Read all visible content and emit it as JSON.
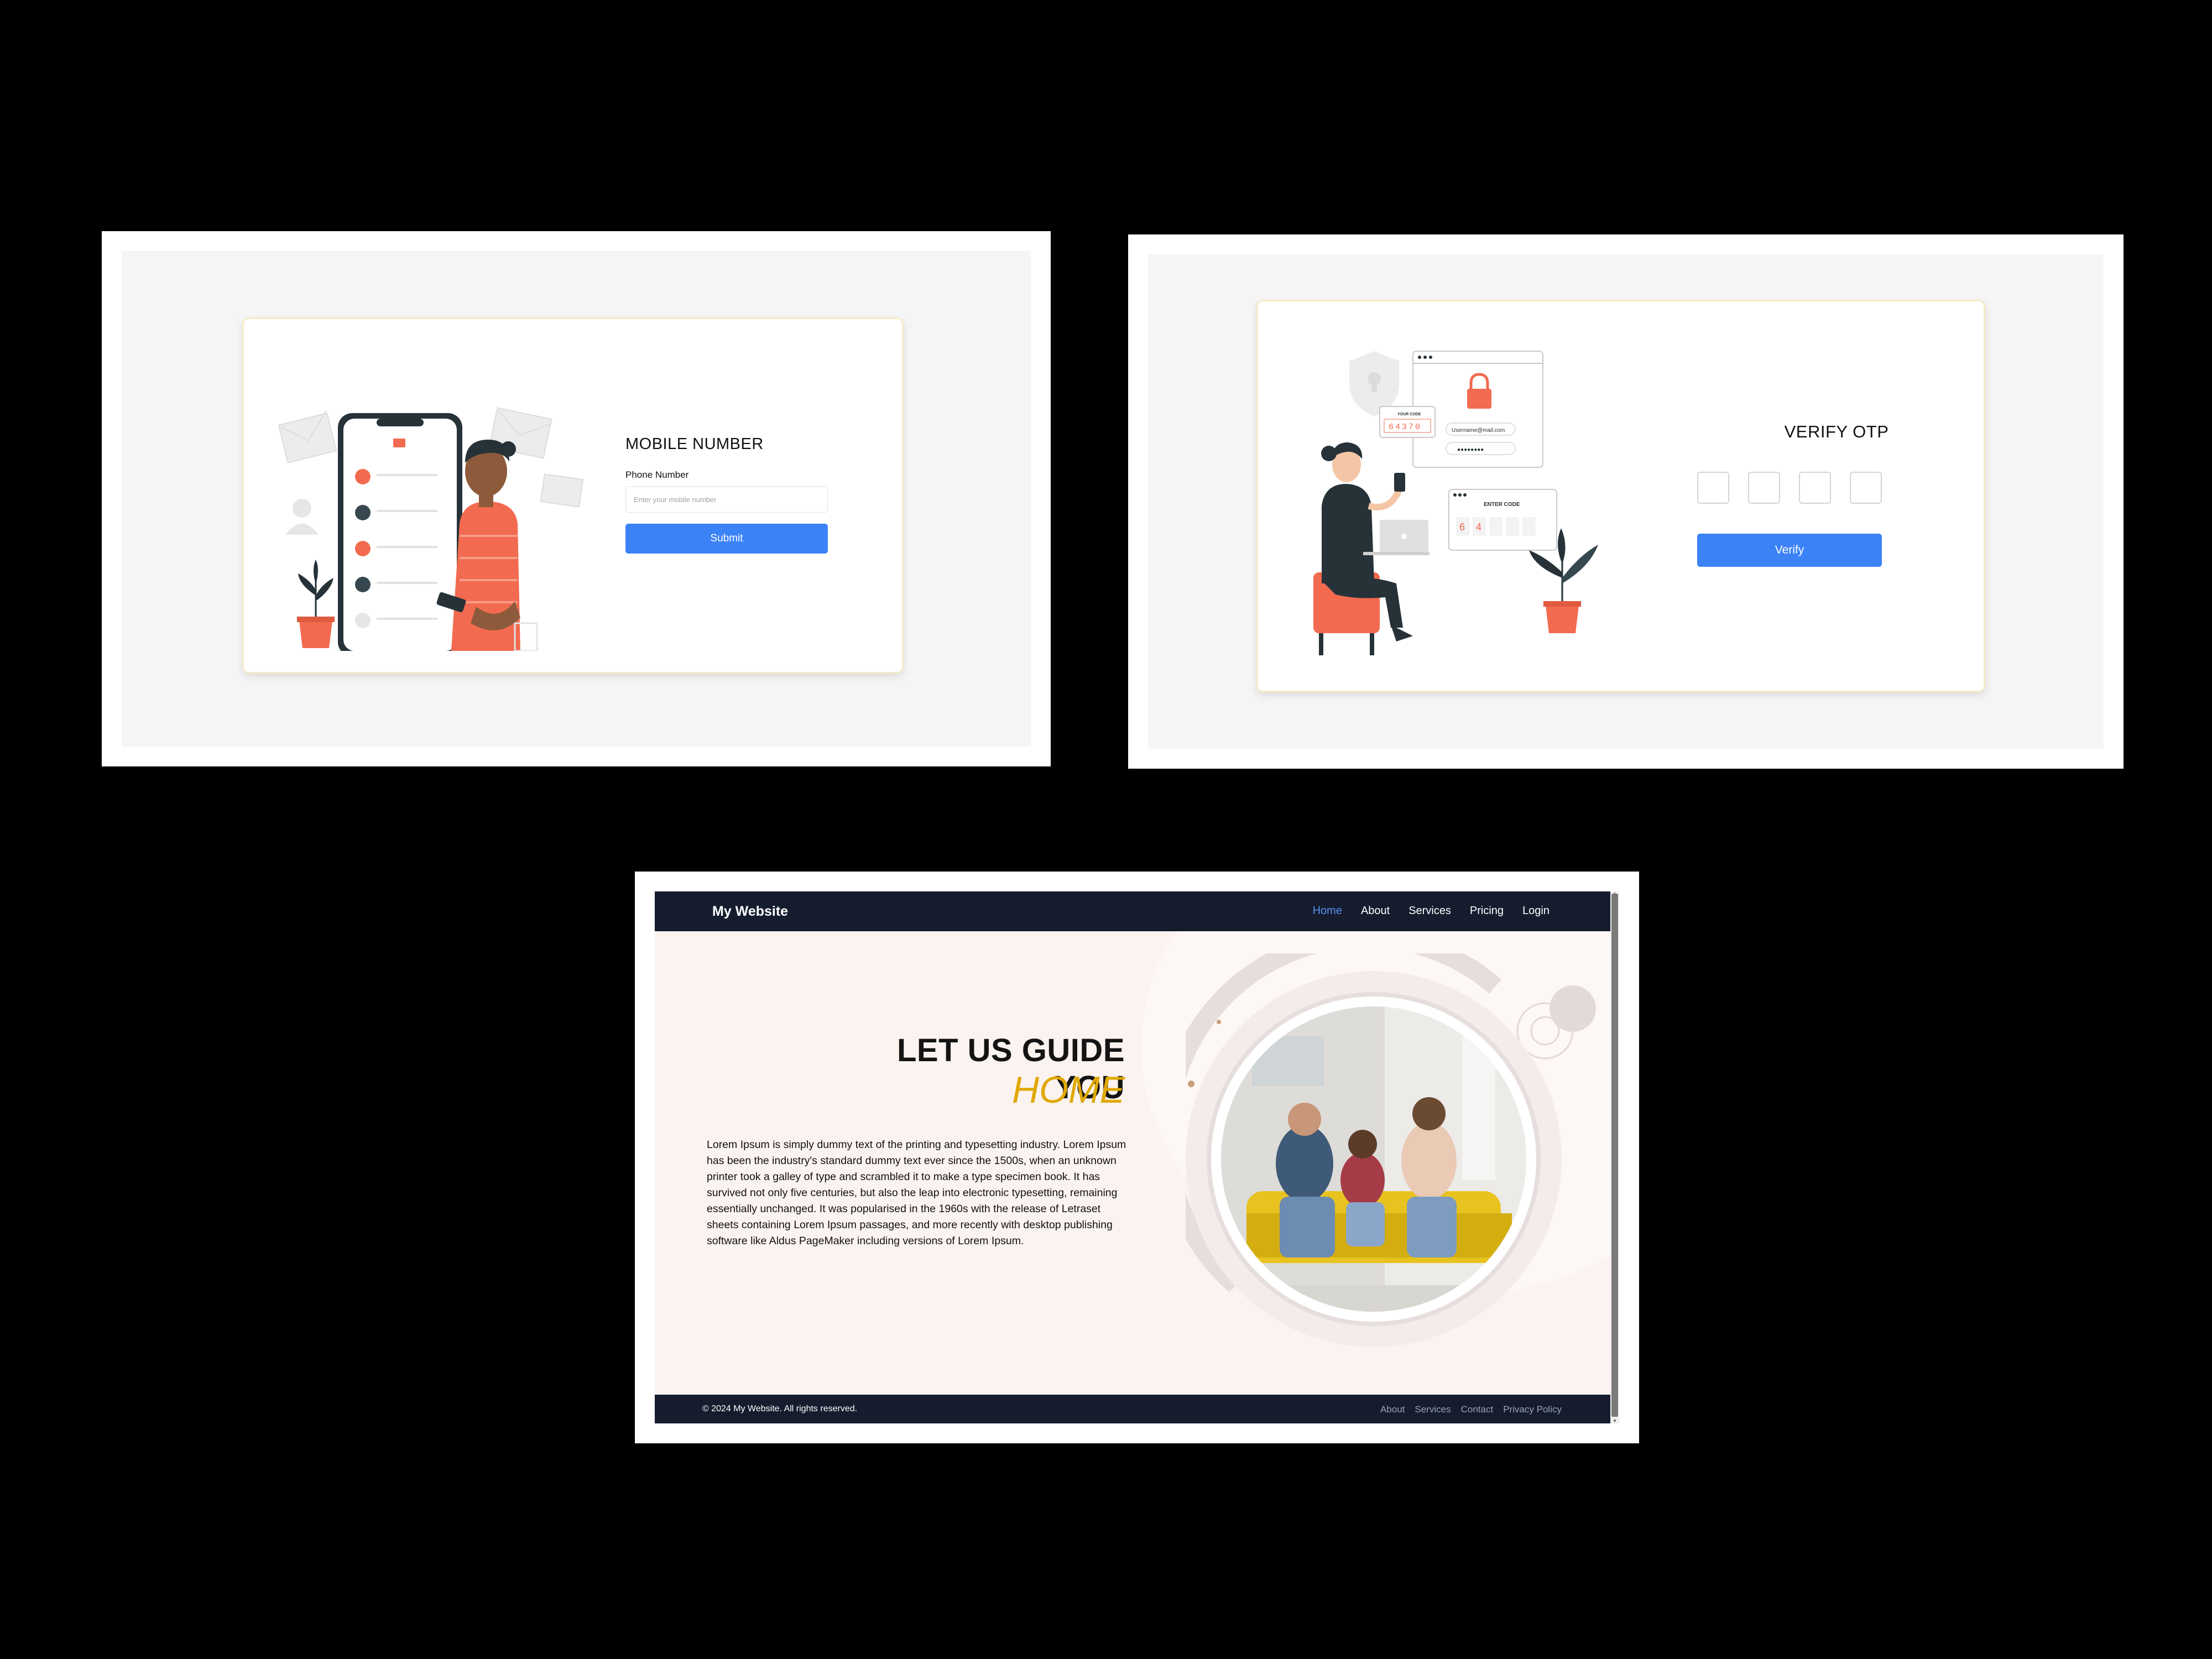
{
  "mobile_screen": {
    "title": "MOBILE NUMBER",
    "phone_label": "Phone Number",
    "phone_placeholder": "Enter your mobile number",
    "phone_value": "",
    "submit_label": "Submit"
  },
  "otp_screen": {
    "title": "VERIFY OTP",
    "otp_digits": [
      "",
      "",
      "",
      ""
    ],
    "verify_label": "Verify",
    "illustration": {
      "code_card_title": "YOUR CODE",
      "code_value": "64370",
      "username": "Username@mail.com",
      "password_mask": "●●●●●●●●",
      "enter_code_title": "ENTER CODE",
      "entered_digits": [
        "6",
        "4"
      ]
    }
  },
  "website_screen": {
    "brand": "My Website",
    "nav": [
      {
        "label": "Home",
        "active": true
      },
      {
        "label": "About",
        "active": false
      },
      {
        "label": "Services",
        "active": false
      },
      {
        "label": "Pricing",
        "active": false
      },
      {
        "label": "Login",
        "active": false
      }
    ],
    "hero": {
      "heading_line1": "LET US GUIDE YOU",
      "heading_line2": "HOME",
      "paragraph": "Lorem Ipsum is simply dummy text of the printing and typesetting industry. Lorem Ipsum has been the industry's standard dummy text ever since the 1500s, when an unknown printer took a galley of type and scrambled it to make a type specimen book. It has survived not only five centuries, but also the leap into electronic typesetting, remaining essentially unchanged. It was popularised in the 1960s with the release of Letraset sheets containing Lorem Ipsum passages, and more recently with desktop publishing software like Aldus PageMaker including versions of Lorem Ipsum."
    },
    "footer": {
      "copyright": "© 2024 My Website. All rights reserved.",
      "links": [
        "About",
        "Services",
        "Contact",
        "Privacy Policy"
      ]
    }
  },
  "colors": {
    "primary_button": "#3b82f6",
    "nav_bg": "#141c2e",
    "accent_gold": "#e0a800",
    "illustration_coral": "#f26a4f",
    "illustration_dark": "#263238"
  },
  "icons": [
    "mail-icon",
    "user-icon",
    "shield-icon",
    "lock-icon",
    "plant-icon",
    "phone-icon",
    "laptop-icon"
  ]
}
